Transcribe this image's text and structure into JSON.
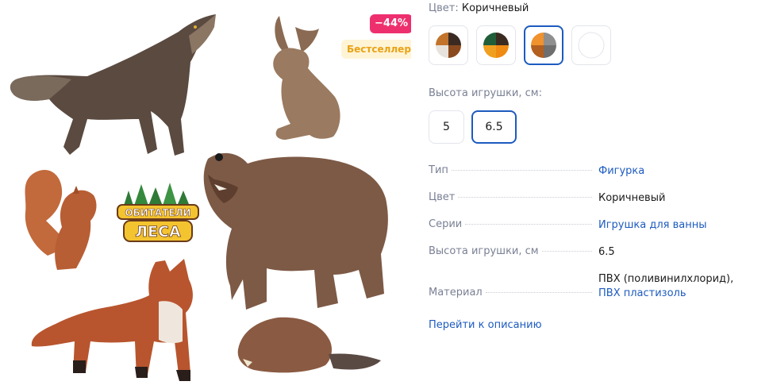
{
  "badges": {
    "discount": "−44%",
    "bestseller": "Бестселлер"
  },
  "product_image": {
    "logo_line1": "ОБИТАТЕЛИ",
    "logo_line2": "ЛЕСА"
  },
  "color_selector": {
    "label": "Цвет:",
    "value": "Коричневый",
    "swatches": [
      {
        "name": "brown-black-orange",
        "colors": [
          "#c2742c",
          "#3b2a22",
          "#e7e2dc",
          "#8a4a1e"
        ]
      },
      {
        "name": "green-orange",
        "colors": [
          "#1f5e38",
          "#3a2a1f",
          "#f0a020",
          "#ef8a12"
        ]
      },
      {
        "name": "orange-grey",
        "colors": [
          "#f0922e",
          "#8f8f8f",
          "#b35f1f",
          "#6e6e6e"
        ]
      },
      {
        "name": "white",
        "colors": [
          "#ffffff"
        ]
      }
    ],
    "selected_index": 2
  },
  "height_selector": {
    "label": "Высота игрушки, см:",
    "options": [
      "5",
      "6.5"
    ],
    "selected": "6.5"
  },
  "specs": [
    {
      "label": "Тип",
      "value": "Фигурка",
      "is_link": true
    },
    {
      "label": "Цвет",
      "value": "Коричневый",
      "is_link": false
    },
    {
      "label": "Серии",
      "value": "Игрушка для ванны",
      "is_link": true
    },
    {
      "label": "Высота игрушки, см",
      "value": "6.5",
      "is_link": false
    },
    {
      "label": "Материал",
      "value_plain": "ПВХ (поливинилхлорид),",
      "value_link": "ПВХ пластизоль"
    }
  ],
  "goto_description": "Перейти к описанию"
}
